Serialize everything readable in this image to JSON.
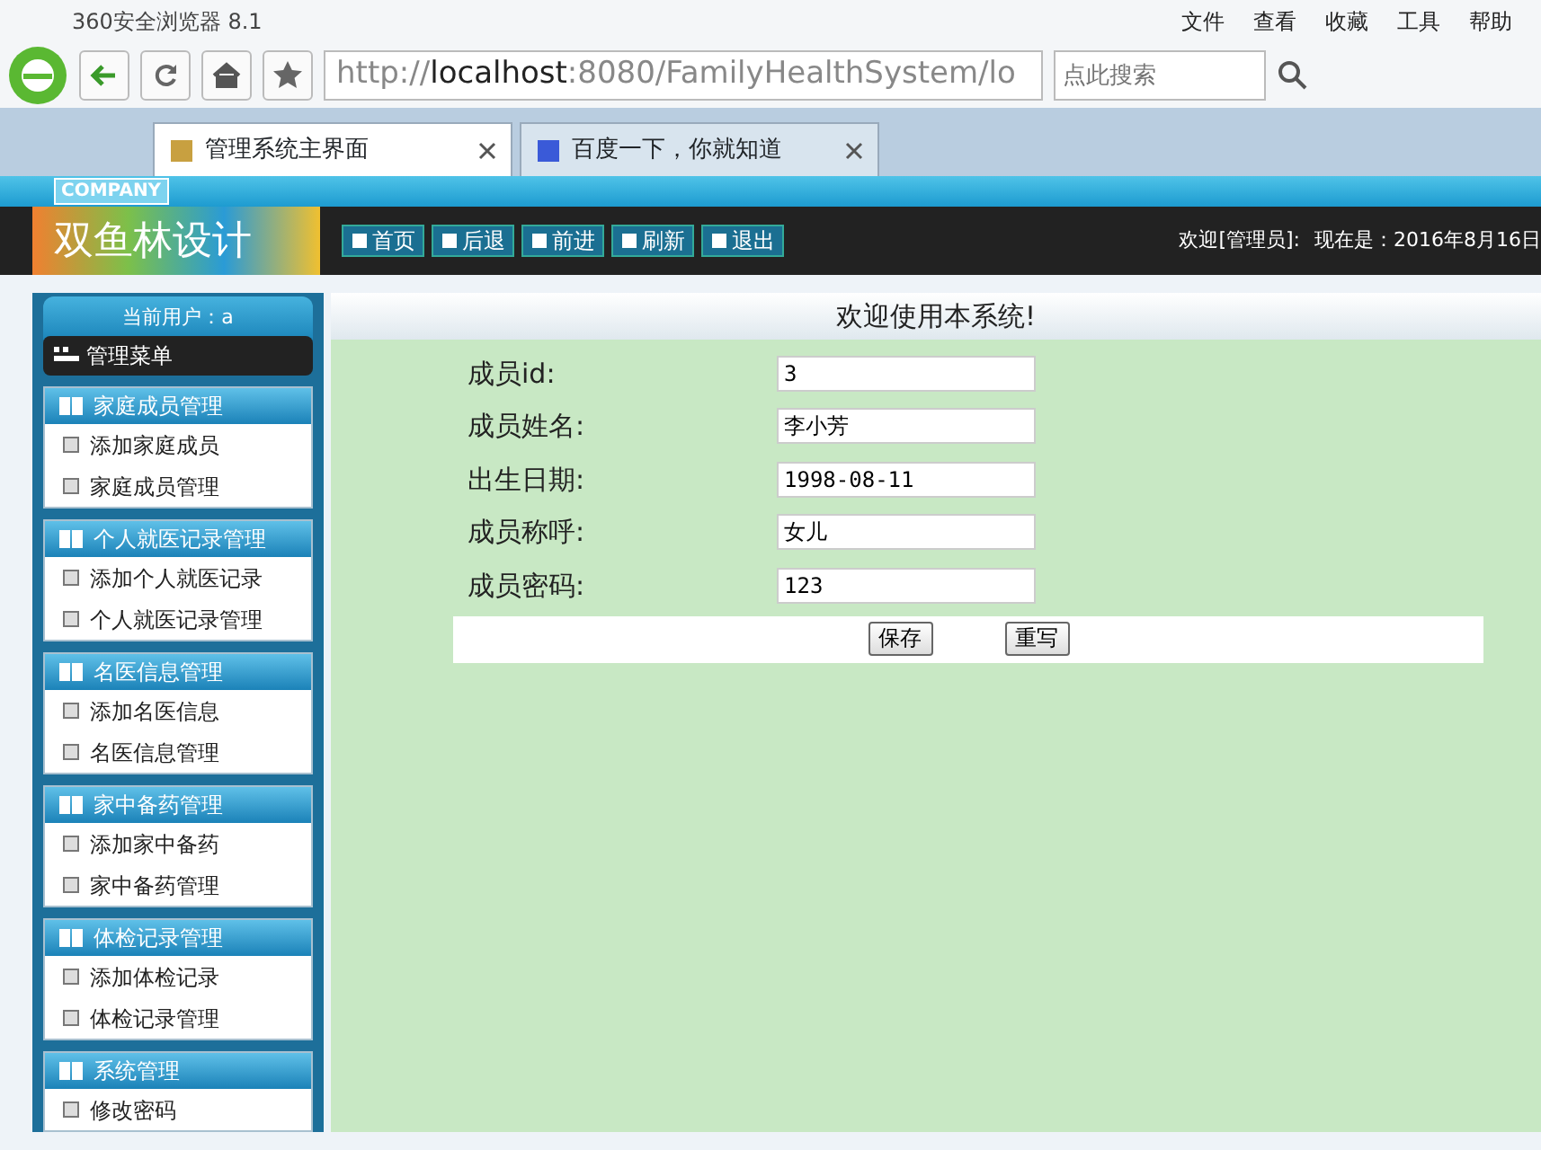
{
  "browser": {
    "title": "360安全浏览器 8.1",
    "menu": [
      "文件",
      "查看",
      "收藏",
      "工具",
      "帮助"
    ],
    "address": "http://**localhost**:8080/FamilyHealthSystem/lo",
    "search": {
      "placeholder": "点此搜索"
    },
    "tabs": [
      {
        "label": "管理系统主界面",
        "selected": true
      },
      {
        "label": "百度一下，你就知道",
        "selected": false
      }
    ]
  },
  "header": {
    "company": "COMPANY",
    "logo": "双鱼林设计",
    "nav": [
      "首页",
      "后退",
      "前进",
      "刷新",
      "退出"
    ],
    "welcome": "欢迎[管理员]:",
    "date": "现在是：2016年8月16日"
  },
  "sidebar": {
    "current_user": "当前用户：a",
    "menu_title": "管理菜单",
    "groups": [
      {
        "title": "家庭成员管理",
        "items": [
          "添加家庭成员",
          "家庭成员管理"
        ]
      },
      {
        "title": "个人就医记录管理",
        "items": [
          "添加个人就医记录",
          "个人就医记录管理"
        ]
      },
      {
        "title": "名医信息管理",
        "items": [
          "添加名医信息",
          "名医信息管理"
        ]
      },
      {
        "title": "家中备药管理",
        "items": [
          "添加家中备药",
          "家中备药管理"
        ]
      },
      {
        "title": "体检记录管理",
        "items": [
          "添加体检记录",
          "体检记录管理"
        ]
      },
      {
        "title": "系统管理",
        "items": [
          "修改密码"
        ]
      }
    ]
  },
  "main": {
    "title": "欢迎使用本系统!",
    "fields": [
      {
        "label": "成员id:",
        "value": "3"
      },
      {
        "label": "成员姓名:",
        "value": "李小芳"
      },
      {
        "label": "出生日期:",
        "value": "1998-08-11"
      },
      {
        "label": "成员称呼:",
        "value": "女儿"
      },
      {
        "label": "成员密码:",
        "value": "123"
      }
    ],
    "buttons": [
      "保存",
      "重写"
    ]
  }
}
